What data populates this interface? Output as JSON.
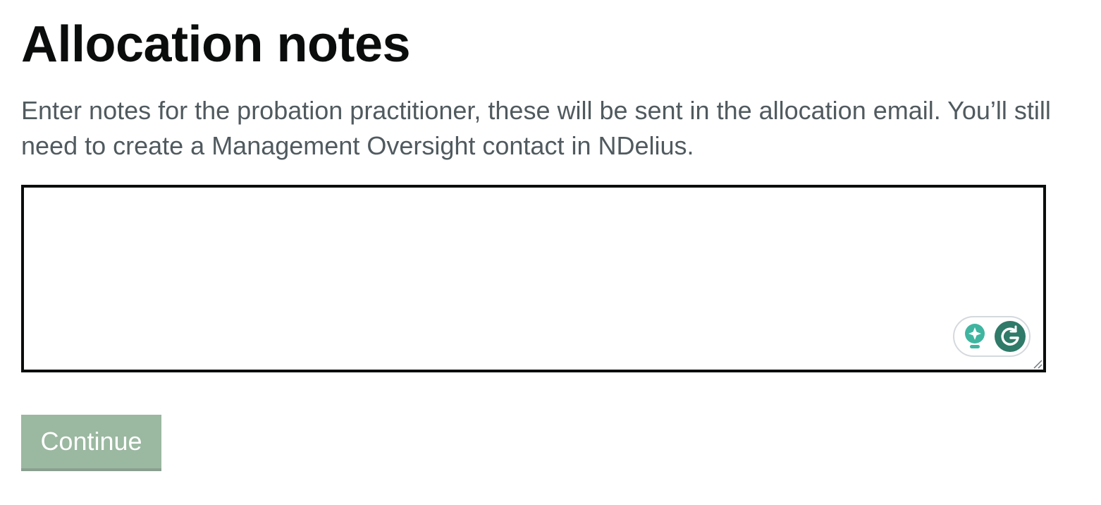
{
  "page": {
    "title": "Allocation notes",
    "hint": "Enter notes for the probation practitioner, these will be sent in the allocation email. You’ll still need to create a Management Oversight contact in NDelius."
  },
  "notes_field": {
    "value": "",
    "placeholder": ""
  },
  "grammarly": {
    "icons": [
      "lightbulb-icon",
      "grammarly-g-icon"
    ],
    "colors": {
      "bulb": "#3fb5a0",
      "g_badge": "#2f7a68"
    }
  },
  "actions": {
    "continue_label": "Continue",
    "continue_color": "#9bb8a1",
    "disabled": true
  }
}
